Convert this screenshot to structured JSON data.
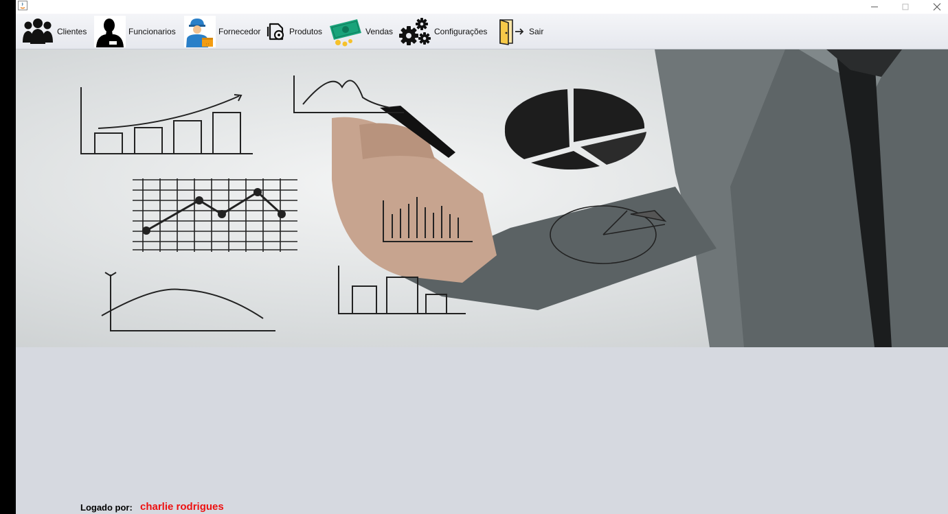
{
  "window": {
    "controls": [
      "minimize",
      "maximize",
      "close"
    ]
  },
  "menu": {
    "items": [
      {
        "label": "Clientes",
        "icon": "users-icon"
      },
      {
        "label": "Funcionarios",
        "icon": "employee-icon"
      },
      {
        "label": "Fornecedor",
        "icon": "supplier-icon"
      },
      {
        "label": "Produtos",
        "icon": "products-icon"
      },
      {
        "label": "Vendas",
        "icon": "money-icon"
      },
      {
        "label": "Configurações",
        "icon": "gears-icon"
      },
      {
        "label": "Sair",
        "icon": "exit-door-icon"
      }
    ]
  },
  "banner": {
    "image": "businessman-drawing-charts"
  },
  "footer": {
    "logged_label": "Logado por:",
    "logged_user": "charlie rodrigues",
    "user_color": "#ee1111"
  }
}
